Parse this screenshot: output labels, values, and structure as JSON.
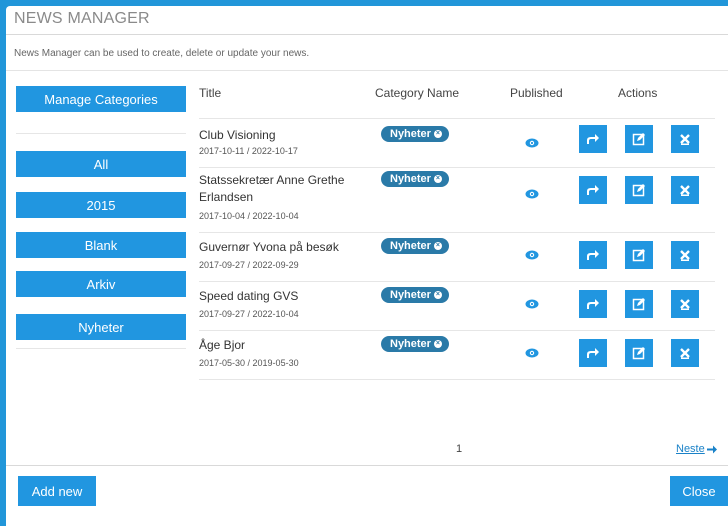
{
  "header": {
    "title": "NEWS MANAGER",
    "description": "News Manager can be used to create, delete or update your news."
  },
  "sidebar": {
    "manage_label": "Manage Categories",
    "categories": [
      "All",
      "2015",
      "Blank",
      "Arkiv",
      "Nyheter"
    ]
  },
  "table": {
    "columns": {
      "title": "Title",
      "category": "Category Name",
      "published": "Published",
      "actions": "Actions"
    },
    "rows": [
      {
        "title": "Club Visioning",
        "dates": "2017-10-11 / 2022-10-17",
        "category": "Nyheter"
      },
      {
        "title": "Statssekretær Anne Grethe Erlandsen",
        "dates": "2017-10-04 / 2022-10-04",
        "category": "Nyheter"
      },
      {
        "title": "Guvernør Yvona på besøk",
        "dates": "2017-09-27 / 2022-09-29",
        "category": "Nyheter"
      },
      {
        "title": "Speed dating GVS",
        "dates": "2017-09-27 / 2022-10-04",
        "category": "Nyheter"
      },
      {
        "title": "Åge Bjor",
        "dates": "2017-05-30 / 2019-05-30",
        "category": "Nyheter"
      }
    ]
  },
  "pagination": {
    "current_page": "1",
    "next_label": "Neste"
  },
  "footer": {
    "add_label": "Add new",
    "close_label": "Close"
  },
  "colors": {
    "primary": "#2196e0",
    "badge": "#2a7aa8",
    "frame": "#2196d9"
  }
}
